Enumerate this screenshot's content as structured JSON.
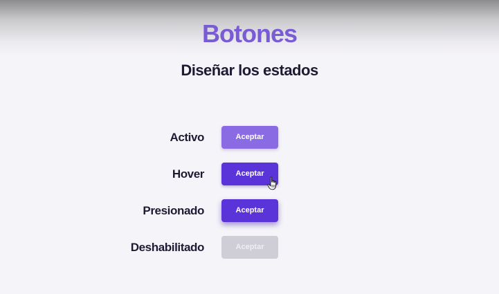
{
  "header": {
    "title": "Botones",
    "subtitle": "Diseñar los estados"
  },
  "states": [
    {
      "label": "Activo",
      "button_label": "Aceptar"
    },
    {
      "label": "Hover",
      "button_label": "Aceptar"
    },
    {
      "label": "Presionado",
      "button_label": "Aceptar"
    },
    {
      "label": "Deshabilitado",
      "button_label": "Aceptar"
    }
  ],
  "colors": {
    "title": "#7a5bd6",
    "text_dark": "#1f1a33",
    "button_active": "#8a6be4",
    "button_hover": "#5a34d8",
    "button_pressed": "#5a34d8",
    "button_disabled": "#cfcdd5",
    "background": "#f5f4f8"
  },
  "icons": {
    "cursor": "hand-pointer-icon"
  }
}
